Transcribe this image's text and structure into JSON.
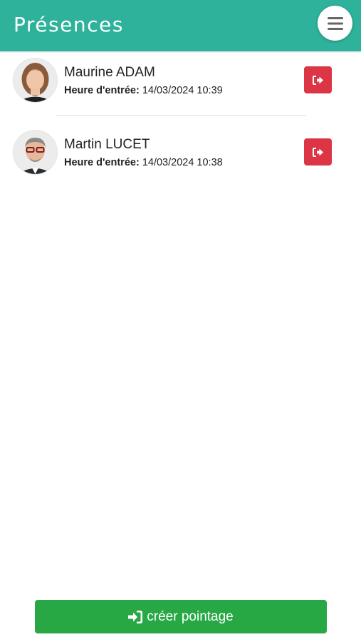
{
  "header": {
    "title": "Présences",
    "menu_icon": "hamburger-icon"
  },
  "colors": {
    "header": "#2fb29b",
    "exit": "#dc3545",
    "create": "#28a745"
  },
  "presences": [
    {
      "name": "Maurine ADAM",
      "entry_label": "Heure d'entrée:",
      "entry_value": "14/03/2024 10:39",
      "exit_icon": "sign-out-icon"
    },
    {
      "name": "Martin LUCET",
      "entry_label": "Heure d'entrée:",
      "entry_value": "14/03/2024 10:38",
      "exit_icon": "sign-out-icon"
    }
  ],
  "footer": {
    "create_label": "créer pointage",
    "create_icon": "sign-in-icon"
  }
}
